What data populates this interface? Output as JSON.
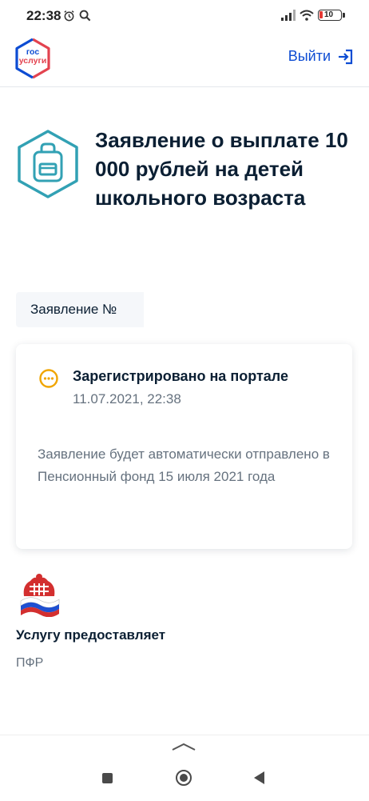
{
  "status_bar": {
    "time": "22:38",
    "battery": "10",
    "icons": [
      "alarm-icon",
      "search-icon",
      "signal-icon",
      "wifi-icon",
      "battery-icon"
    ]
  },
  "header": {
    "logo_line1": "гос",
    "logo_line2": "услуги",
    "logout_label": "Выйти",
    "logout_icon": "logout-icon"
  },
  "page": {
    "title": "Заявление о выплате 10 000 рублей на детей школьного возраста",
    "icon": "backpack-icon"
  },
  "application": {
    "number_label": "Заявление №"
  },
  "status_card": {
    "icon": "pending-icon",
    "status": "Зарегистрировано на портале",
    "date": "11.07.2021, 22:38",
    "description": "Заявление будет автоматически отправлено в Пенсионный фонд 15 июля 2021 года"
  },
  "provider": {
    "label": "Услугу предоставляет",
    "name": "ПФР",
    "logo": "pfr-logo"
  },
  "colors": {
    "brand_blue": "#0d4cd3",
    "brand_red": "#e3434f",
    "icon_teal": "#32a1b4",
    "pending_orange": "#f0a500",
    "text_primary": "#0b1f33",
    "text_secondary": "#66727f"
  }
}
